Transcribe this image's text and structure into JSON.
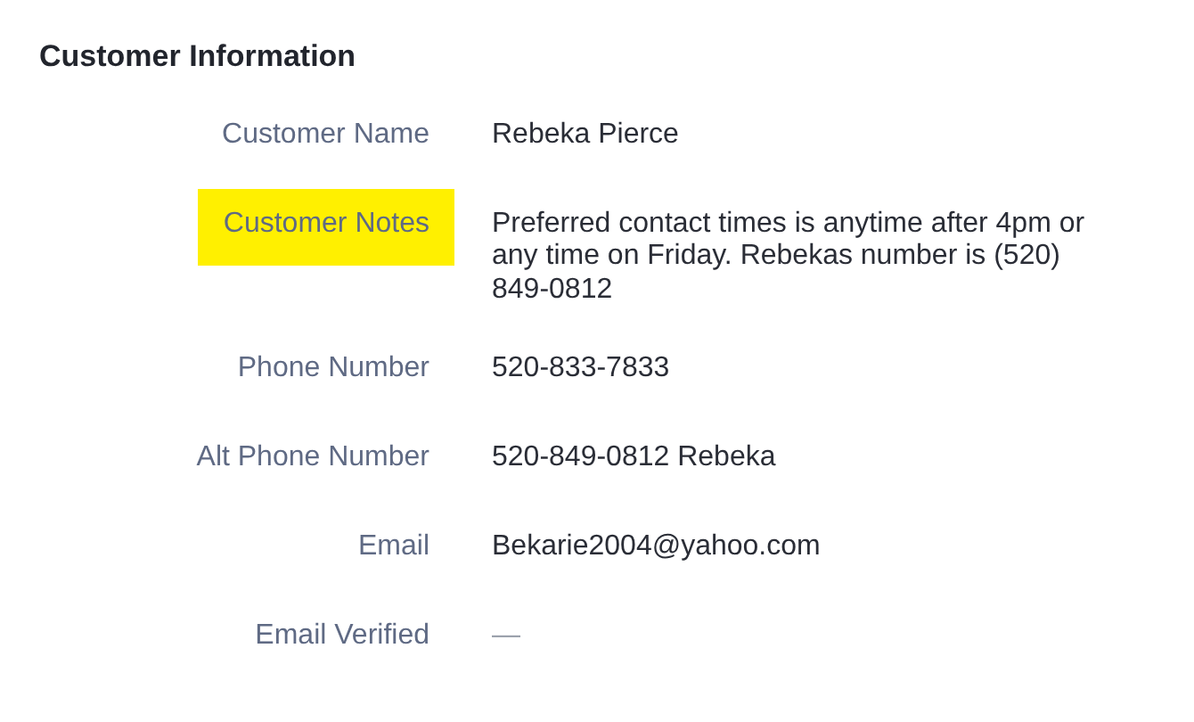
{
  "section": {
    "title": "Customer Information",
    "fields": [
      {
        "label": "Customer Name",
        "value": "Rebeka Pierce",
        "highlighted": false,
        "kind": "text"
      },
      {
        "label": "Customer Notes",
        "value": "Preferred contact times is anytime after 4pm or any time on Friday. Rebekas number is (520) 849-0812",
        "highlighted": true,
        "kind": "text"
      },
      {
        "label": "Phone Number",
        "value": "520-833-7833",
        "highlighted": false,
        "kind": "text"
      },
      {
        "label": "Alt Phone Number",
        "value": "520-849-0812 Rebeka",
        "highlighted": false,
        "kind": "text"
      },
      {
        "label": "Email",
        "value": "Bekarie2004@yahoo.com",
        "highlighted": false,
        "kind": "text"
      },
      {
        "label": "Email Verified",
        "value": "—",
        "highlighted": false,
        "kind": "empty"
      }
    ]
  }
}
